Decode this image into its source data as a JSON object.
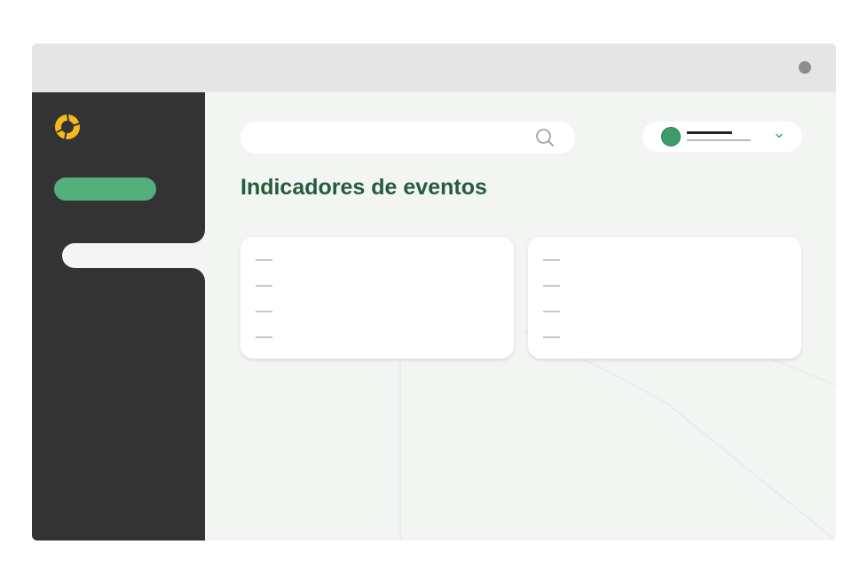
{
  "window": {
    "title": ""
  },
  "sidebar": {
    "logo_icon": "brand-logo-icon",
    "logo_colors": [
      "#f7b71e",
      "#333333"
    ],
    "nav_items": [
      {
        "label": "",
        "state": "highlighted",
        "color": "#53b07d"
      },
      {
        "label": "",
        "state": "selected"
      }
    ]
  },
  "header": {
    "search": {
      "value": "",
      "placeholder": "",
      "icon": "search-icon"
    },
    "user": {
      "name": "",
      "role": "",
      "avatar_color": "#3d9c6a",
      "menu_icon": "chevron-down-icon"
    }
  },
  "main": {
    "title": "Indicadores de eventos",
    "cards": [
      {
        "items": [
          "",
          "",
          "",
          ""
        ]
      },
      {
        "items": [
          "",
          "",
          "",
          ""
        ]
      }
    ]
  },
  "colors": {
    "accent": "#53b07d",
    "title": "#245c3c",
    "sidebar": "#333333",
    "brand": "#f7b71e"
  }
}
